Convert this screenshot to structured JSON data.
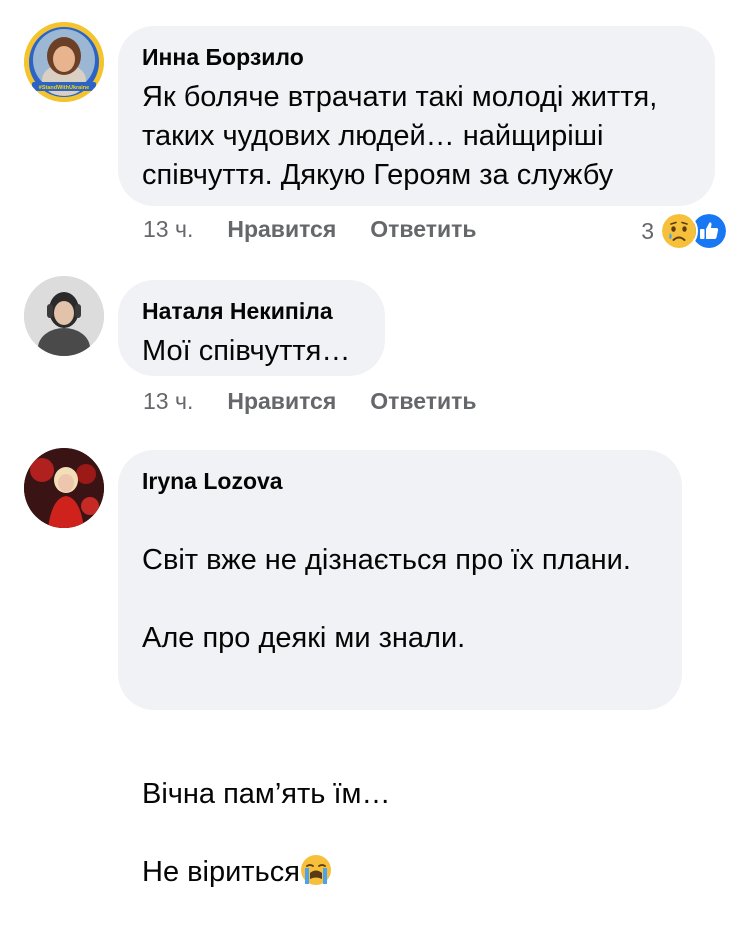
{
  "comments": [
    {
      "author": "Инна Борзило",
      "text": "Як боляче втрачати такі молоді життя,\nтаких чудових людей… найщиріші\nспівчуття. Дякую Героям за службу",
      "time": "13 ч.",
      "like_label": "Нравится",
      "reply_label": "Ответить",
      "reaction_count": "3",
      "reactions": [
        "sad-emoji",
        "like-emoji"
      ],
      "avatar_badge": "#StandWithUkraine"
    },
    {
      "author": "Наталя Некипіла",
      "text": "Мої співчуття…",
      "time": "13 ч.",
      "like_label": "Нравится",
      "reply_label": "Ответить"
    },
    {
      "author": "Iryna Lozova",
      "text_lines": [
        "Світ вже не дізнається про їх плани.",
        "Але про деякі ми знали.",
        "",
        "Вічна пам’ять їм…"
      ],
      "last_line": "Не віриться",
      "last_line_emoji": "crying-face-emoji"
    }
  ],
  "colors": {
    "bubble": "#f0f2f5",
    "text": "#050505",
    "secondary": "#65676b",
    "like_blue": "#1877f2",
    "sad_yellow": "#f7c03a"
  }
}
